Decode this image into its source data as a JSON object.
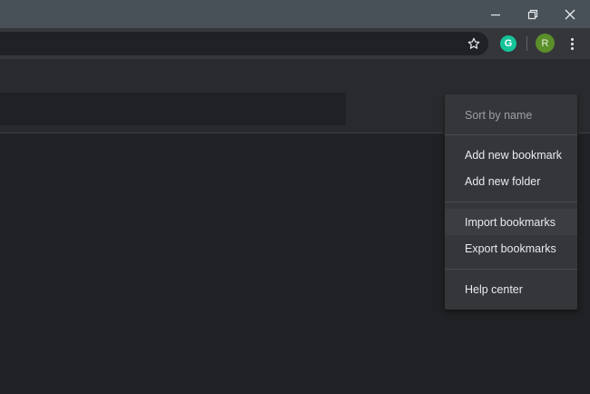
{
  "window": {
    "minimize_icon": "minimize-icon",
    "restore_icon": "restore-icon",
    "close_icon": "close-icon"
  },
  "toolbar": {
    "bookmark_star_icon": "star-icon",
    "extension": {
      "name": "grammarly-icon",
      "letter": "G",
      "color": "#15c39a"
    },
    "profile": {
      "initial": "R",
      "color": "#5b8f2a"
    },
    "menu_icon": "three-dots-icon"
  },
  "bookmark_menu": {
    "items": [
      {
        "label": "Sort by name",
        "enabled": false
      },
      {
        "label": "Add new bookmark",
        "enabled": true
      },
      {
        "label": "Add new folder",
        "enabled": true
      },
      {
        "label": "Import bookmarks",
        "enabled": true,
        "hovered": true
      },
      {
        "label": "Export bookmarks",
        "enabled": true
      },
      {
        "label": "Help center",
        "enabled": true
      }
    ]
  }
}
